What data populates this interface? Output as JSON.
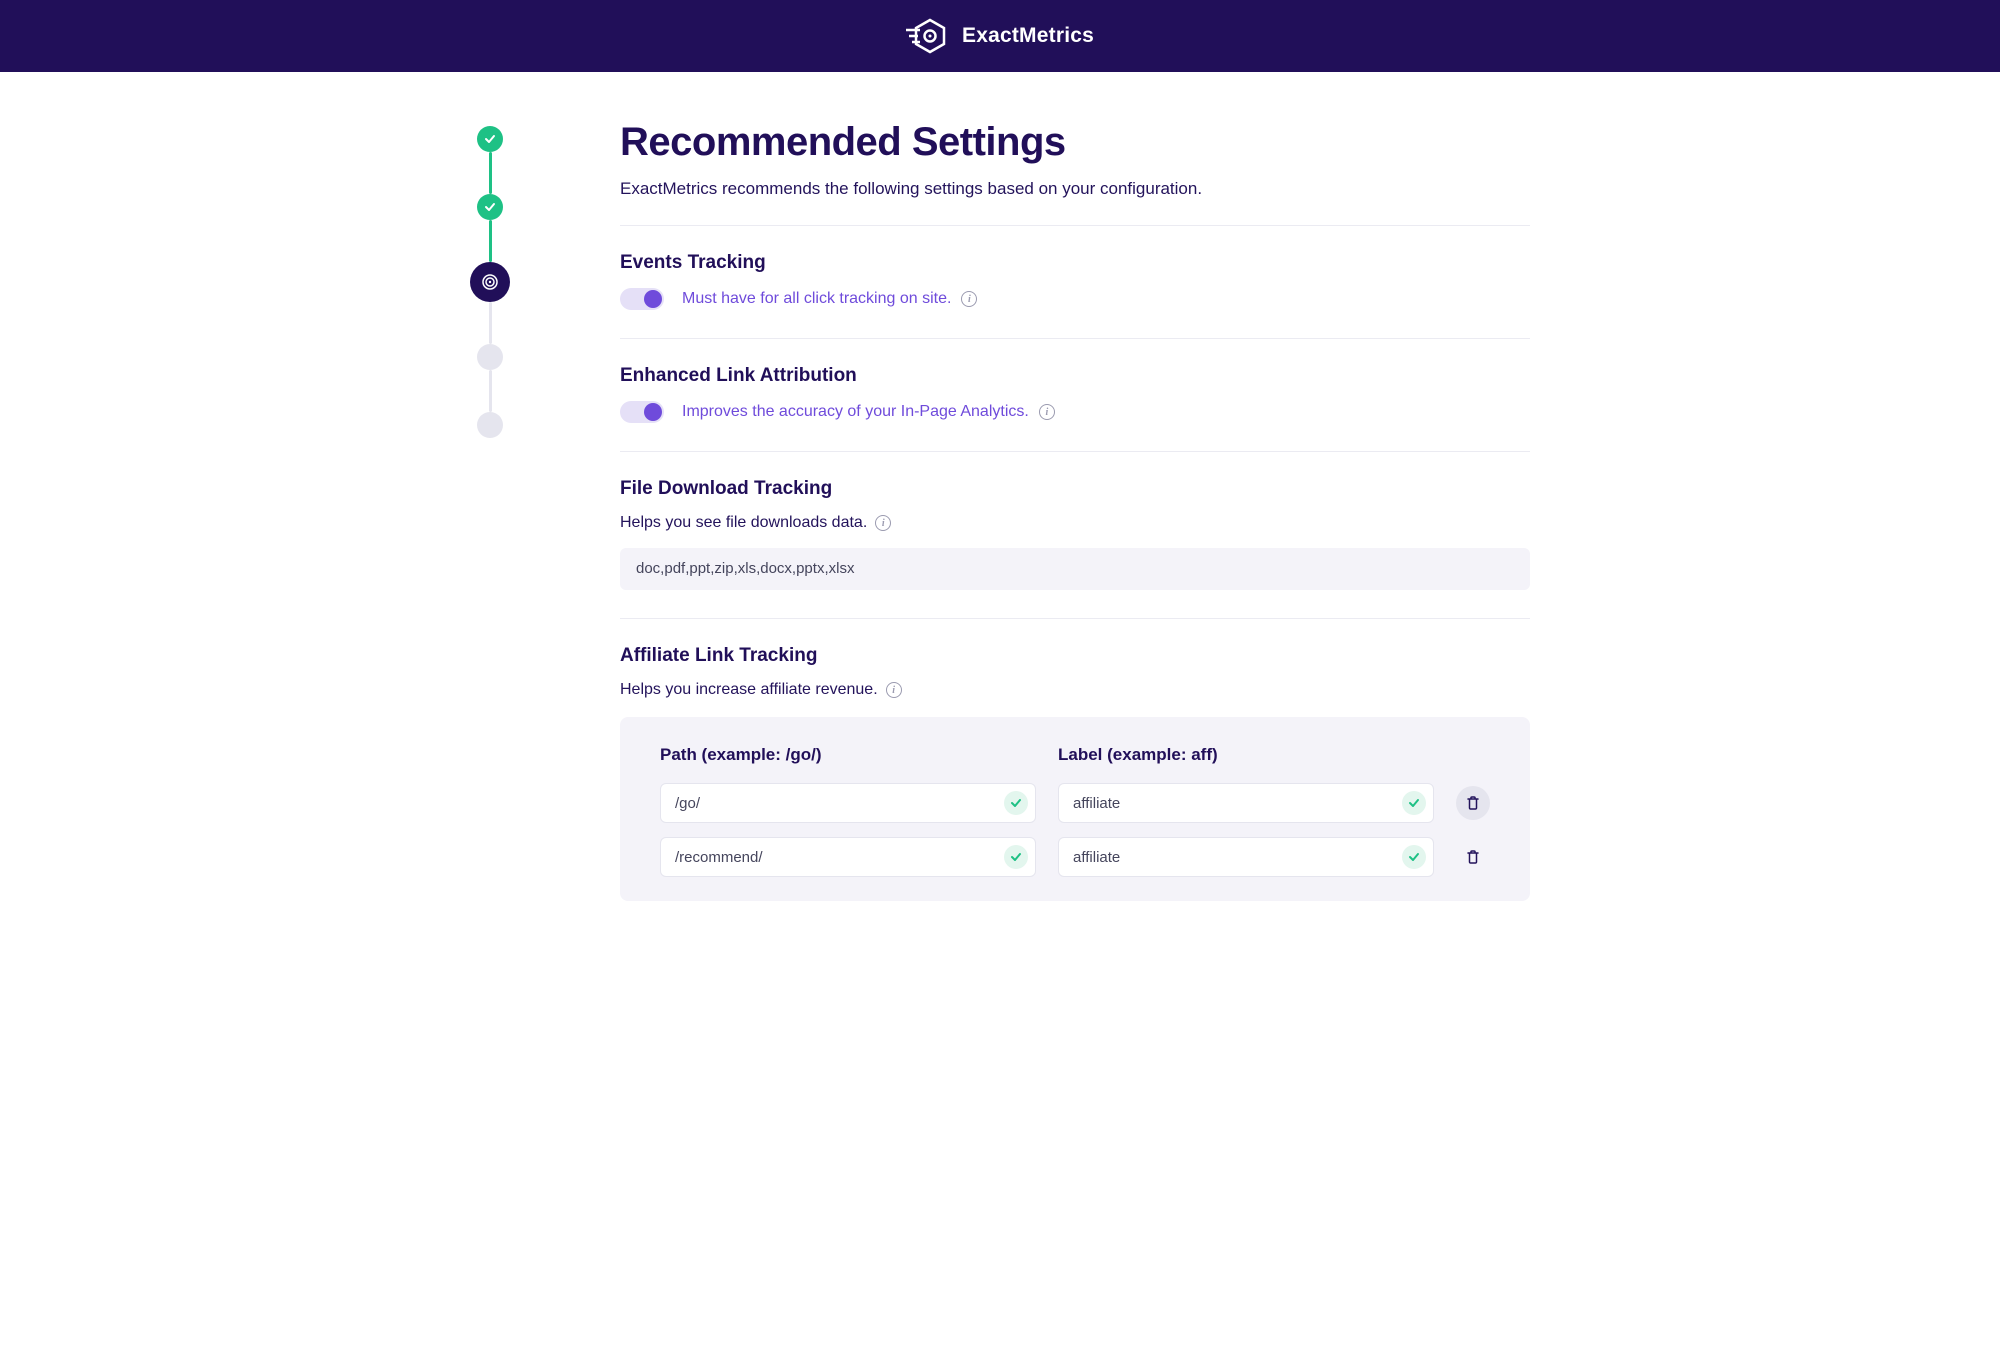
{
  "brand": {
    "name": "ExactMetrics"
  },
  "page": {
    "title": "Recommended Settings",
    "subtitle": "ExactMetrics recommends the following settings based on your configuration."
  },
  "stepper": {
    "steps": [
      {
        "state": "done"
      },
      {
        "state": "done"
      },
      {
        "state": "current"
      },
      {
        "state": "pending"
      },
      {
        "state": "pending"
      }
    ]
  },
  "sections": {
    "events": {
      "title": "Events Tracking",
      "toggle_on": true,
      "label": "Must have for all click tracking on site."
    },
    "enhanced": {
      "title": "Enhanced Link Attribution",
      "toggle_on": true,
      "label": "Improves the accuracy of your In-Page Analytics."
    },
    "download": {
      "title": "File Download Tracking",
      "description": "Helps you see file downloads data.",
      "value": "doc,pdf,ppt,zip,xls,docx,pptx,xlsx"
    },
    "affiliate": {
      "title": "Affiliate Link Tracking",
      "description": "Helps you increase affiliate revenue.",
      "path_header": "Path (example: /go/)",
      "label_header": "Label (example: aff)",
      "rows": [
        {
          "path": "/go/",
          "label": "affiliate"
        },
        {
          "path": "/recommend/",
          "label": "affiliate"
        }
      ]
    }
  }
}
